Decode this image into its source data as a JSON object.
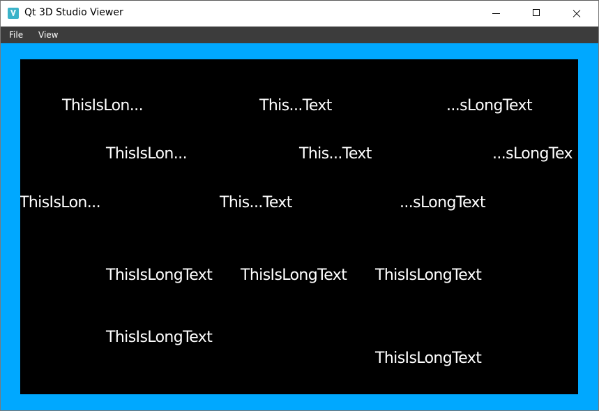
{
  "window": {
    "title": "Qt 3D Studio Viewer",
    "icon": "qt-3d-studio-icon"
  },
  "menu": {
    "file": "File",
    "view": "View"
  },
  "colors": {
    "viewport_background": "#00a8ff",
    "scene_background": "#000000",
    "text": "#ffffff",
    "menubar": "#3c3c3c"
  },
  "scene": {
    "labels": [
      "ThisIsLon...",
      "This...Text",
      "...sLongText",
      "ThisIsLon...",
      "This...Text",
      "...sLongTex",
      "ThisIsLon...",
      "This...Text",
      "...sLongText",
      "ThisIsLongText",
      "ThisIsLongText",
      "ThisIsLongText",
      "ThisIsLongText",
      "ThisIsLongText"
    ]
  }
}
